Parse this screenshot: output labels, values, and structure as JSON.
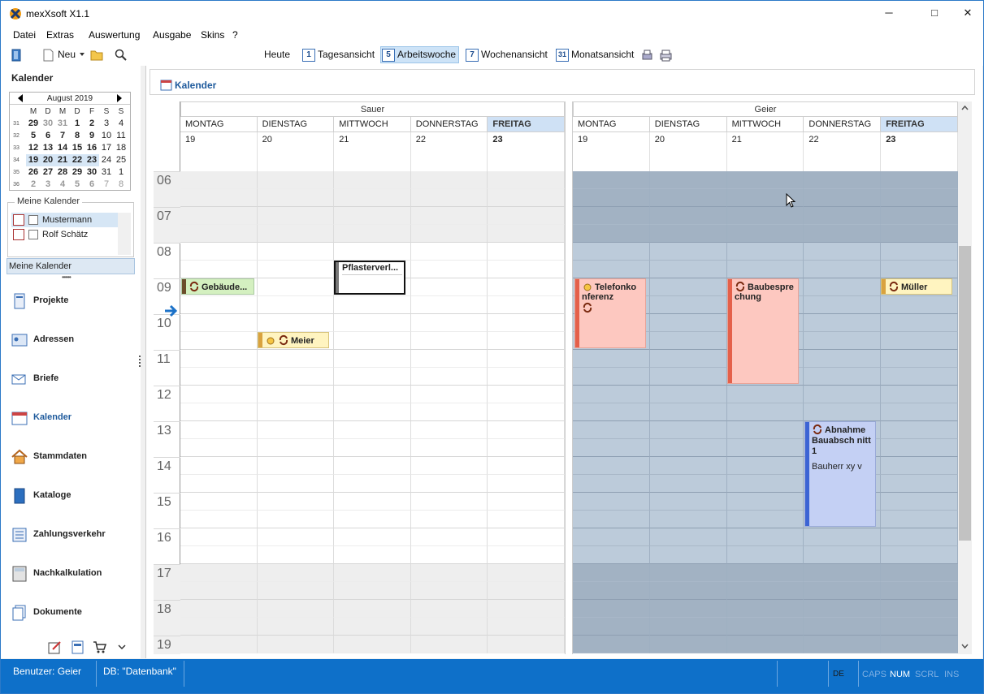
{
  "window": {
    "title": "mexXsoft X1.1",
    "minimize": "─",
    "maximize": "□",
    "close": "✕"
  },
  "menu": [
    "Datei",
    "Extras",
    "Auswertung",
    "Ausgabe",
    "Skins",
    "?"
  ],
  "toolbar": {
    "new_label": "Neu",
    "today": "Heute",
    "views": [
      "Tagesansicht",
      "Arbeitswoche",
      "Wochenansicht",
      "Monatsansicht"
    ],
    "view_icons": [
      "1",
      "5",
      "7",
      "31"
    ],
    "active_view": "Arbeitswoche"
  },
  "sidebar": {
    "title": "Kalender",
    "minical": {
      "month": "August 2019",
      "daynames": [
        "M",
        "D",
        "M",
        "D",
        "F",
        "S",
        "S"
      ],
      "weeks": [
        {
          "wk": "31",
          "days": [
            "29",
            "30",
            "31",
            "1",
            "2",
            "3",
            "4"
          ]
        },
        {
          "wk": "32",
          "days": [
            "5",
            "6",
            "7",
            "8",
            "9",
            "10",
            "11"
          ]
        },
        {
          "wk": "33",
          "days": [
            "12",
            "13",
            "14",
            "15",
            "16",
            "17",
            "18"
          ]
        },
        {
          "wk": "34",
          "days": [
            "19",
            "20",
            "21",
            "22",
            "23",
            "24",
            "25"
          ]
        },
        {
          "wk": "35",
          "days": [
            "26",
            "27",
            "28",
            "29",
            "30",
            "31",
            "1"
          ]
        },
        {
          "wk": "36",
          "days": [
            "2",
            "3",
            "4",
            "5",
            "6",
            "7",
            "8"
          ]
        }
      ]
    },
    "my_calendars_title": "Meine Kalender",
    "calendars": [
      "Mustermann",
      "Rolf Schätz"
    ],
    "my_calendars_bar": "Meine Kalender",
    "grip": "••••••",
    "nav": [
      "Projekte",
      "Adressen",
      "Briefe",
      "Kalender",
      "Stammdaten",
      "Kataloge",
      "Zahlungsverkehr",
      "Nachkalkulation",
      "Dokumente"
    ],
    "nav_selected": "Kalender"
  },
  "main": {
    "title": "Kalender",
    "hours": [
      "06",
      "07",
      "08",
      "09",
      "10",
      "11",
      "12",
      "13",
      "14",
      "15",
      "16",
      "17",
      "18",
      "19"
    ],
    "resources": [
      {
        "name": "Sauer",
        "days": [
          {
            "name": "MONTAG",
            "num": "19"
          },
          {
            "name": "DIENSTAG",
            "num": "20"
          },
          {
            "name": "MITTWOCH",
            "num": "21"
          },
          {
            "name": "DONNERSTAG",
            "num": "22"
          },
          {
            "name": "FREITAG",
            "num": "23"
          }
        ]
      },
      {
        "name": "Geier",
        "days": [
          {
            "name": "MONTAG",
            "num": "19"
          },
          {
            "name": "DIENSTAG",
            "num": "20"
          },
          {
            "name": "MITTWOCH",
            "num": "21"
          },
          {
            "name": "DONNERSTAG",
            "num": "22"
          },
          {
            "name": "FREITAG",
            "num": "23"
          }
        ]
      }
    ],
    "events": {
      "gebaeude": "Gebäude...",
      "meier": "Meier",
      "pflaster": "Pflasterverl...",
      "telefon": "Telefonko nferenz",
      "baubesp": "Baubespre chung",
      "mueller": "Müller",
      "abnahme": "Abnahme Bauabsch nitt 1",
      "abnahme_sub": "Bauherr xy v"
    }
  },
  "status": {
    "user": "Benutzer: Geier",
    "db": "DB: \"Datenbank\"",
    "lang": "DE",
    "indicators": [
      "CAPS",
      "NUM",
      "SCRL",
      "INS"
    ],
    "active_indicator": "NUM"
  },
  "colors": {
    "accent": "#0e70c9",
    "selected_day": "#cfe1f5",
    "geier_bg": "#bccbda",
    "geier_offhours": "#a2b2c3",
    "offhours": "#eeeeee",
    "ev_green": "#d4f0c0",
    "ev_yellow": "#fff4c0",
    "ev_red": "#fdc8c0",
    "ev_blue": "#c4d0f4"
  }
}
